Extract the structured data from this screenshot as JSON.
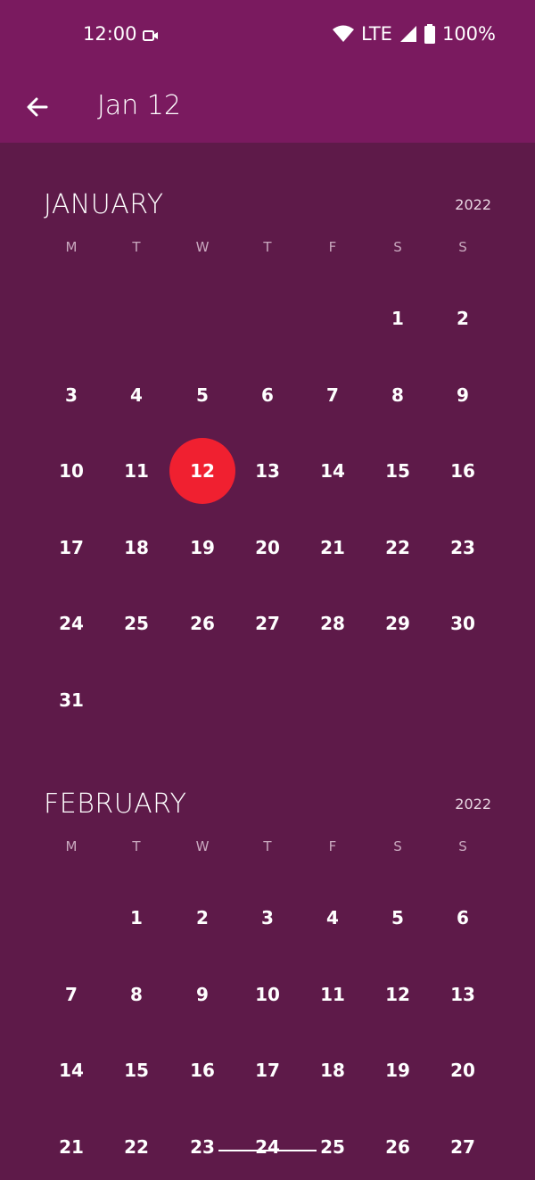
{
  "status_bar": {
    "time": "12:00",
    "network": "LTE",
    "battery": "100%"
  },
  "toolbar": {
    "title": "Jan 12"
  },
  "weekdays": [
    "M",
    "T",
    "W",
    "T",
    "F",
    "S",
    "S"
  ],
  "months": [
    {
      "name": "JANUARY",
      "year": "2022",
      "weeks": [
        [
          "",
          "",
          "",
          "",
          "",
          "1",
          "2"
        ],
        [
          "3",
          "4",
          "5",
          "6",
          "7",
          "8",
          "9"
        ],
        [
          "10",
          "11",
          "12",
          "13",
          "14",
          "15",
          "16"
        ],
        [
          "17",
          "18",
          "19",
          "20",
          "21",
          "22",
          "23"
        ],
        [
          "24",
          "25",
          "26",
          "27",
          "28",
          "29",
          "30"
        ],
        [
          "31",
          "",
          "",
          "",
          "",
          "",
          ""
        ]
      ],
      "selected": "12"
    },
    {
      "name": "FEBRUARY",
      "year": "2022",
      "weeks": [
        [
          "",
          "1",
          "2",
          "3",
          "4",
          "5",
          "6"
        ],
        [
          "7",
          "8",
          "9",
          "10",
          "11",
          "12",
          "13"
        ],
        [
          "14",
          "15",
          "16",
          "17",
          "18",
          "19",
          "20"
        ],
        [
          "21",
          "22",
          "23",
          "24",
          "25",
          "26",
          "27"
        ]
      ],
      "selected": ""
    }
  ],
  "colors": {
    "appbar": "#7a1a5f",
    "background": "#5e1a49",
    "selected": "#f02030"
  }
}
